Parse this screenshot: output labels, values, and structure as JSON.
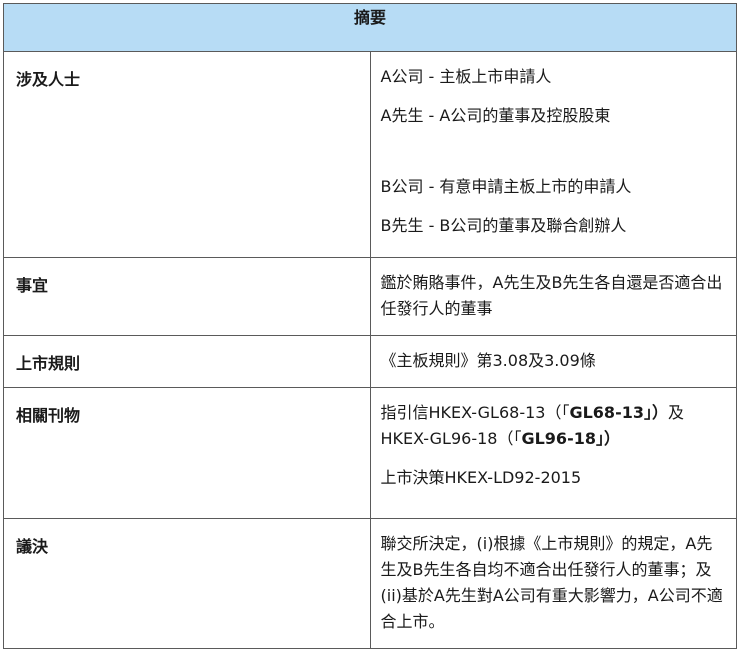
{
  "header": "摘要",
  "rows": {
    "parties": {
      "label": "涉及人士",
      "lines": [
        "A公司 - 主板上市申請人",
        "A先生 - A公司的董事及控股股東",
        "B公司 - 有意申請主板上市的申請人",
        "B先生 - B公司的董事及聯合創辦人"
      ]
    },
    "subject": {
      "label": "事宜",
      "text": "鑑於賄賂事件，A先生及B先生各自還是否適合出任發行人的董事"
    },
    "rules": {
      "label": "上市規則",
      "text": "《主板規則》第3.08及3.09條"
    },
    "publications": {
      "label": "相關刊物",
      "guidance_prefix": "指引信HKEX-GL68-13（「",
      "guidance_code1": "GL68-13」）",
      "guidance_mid": "及HKEX-GL96-18（「",
      "guidance_code2": "GL96-18」）",
      "decision": "上市決策HKEX-LD92-2015"
    },
    "decision": {
      "label": "議決",
      "text": "聯交所決定，(i)根據《上市規則》的規定，A先生及B先生各自均不適合出任發行人的董事；及(ii)基於A先生對A公司有重大影響力，A公司不適合上市。"
    }
  }
}
